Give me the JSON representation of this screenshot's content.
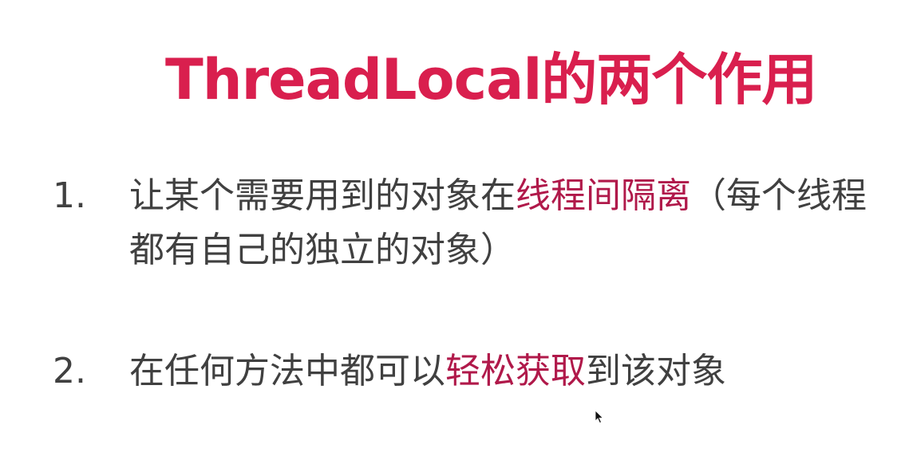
{
  "slide": {
    "title": "ThreadLocal的两个作用",
    "items": [
      {
        "number": "1.",
        "before": "让某个需要用到的对象在",
        "highlight": "线程间隔离",
        "after": "（每个线程都有自己的独立的对象）"
      },
      {
        "number": "2.",
        "before": "在任何方法中都可以",
        "highlight": "轻松获取",
        "after": "到该对象"
      }
    ]
  },
  "colors": {
    "title": "#d91f4e",
    "highlight": "#b0194a",
    "body_text": "#404040"
  },
  "icons": {
    "cursor": "mouse-pointer-icon"
  }
}
